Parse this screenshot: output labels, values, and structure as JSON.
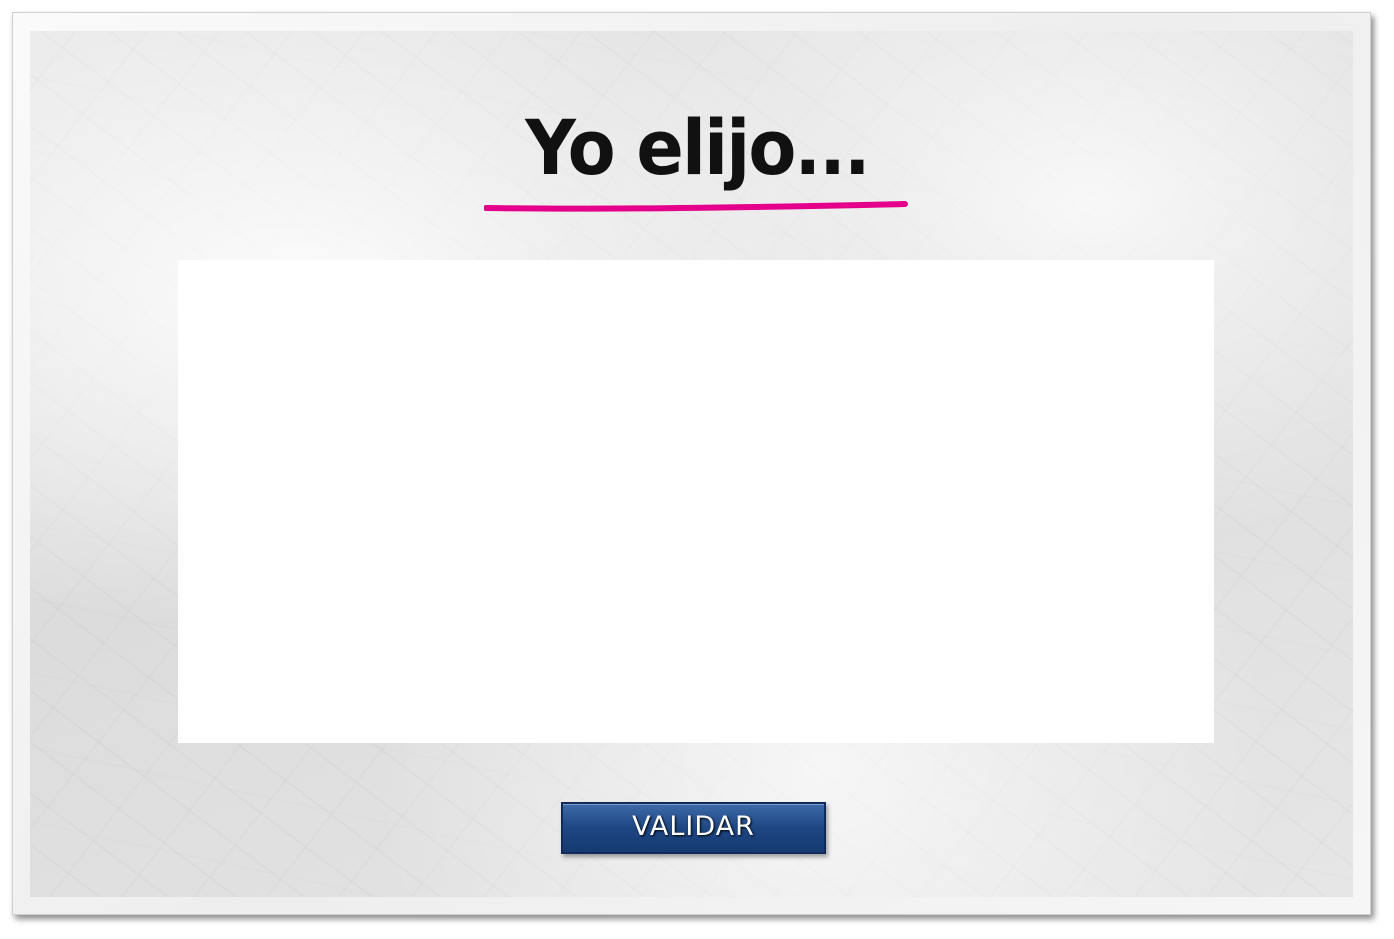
{
  "title": "Yo elijo...",
  "content_area": {
    "text": ""
  },
  "validate_button": {
    "label": "VALIDAR"
  },
  "colors": {
    "underline": "#e4008a",
    "button": "#1e4683",
    "title": "#111111"
  }
}
